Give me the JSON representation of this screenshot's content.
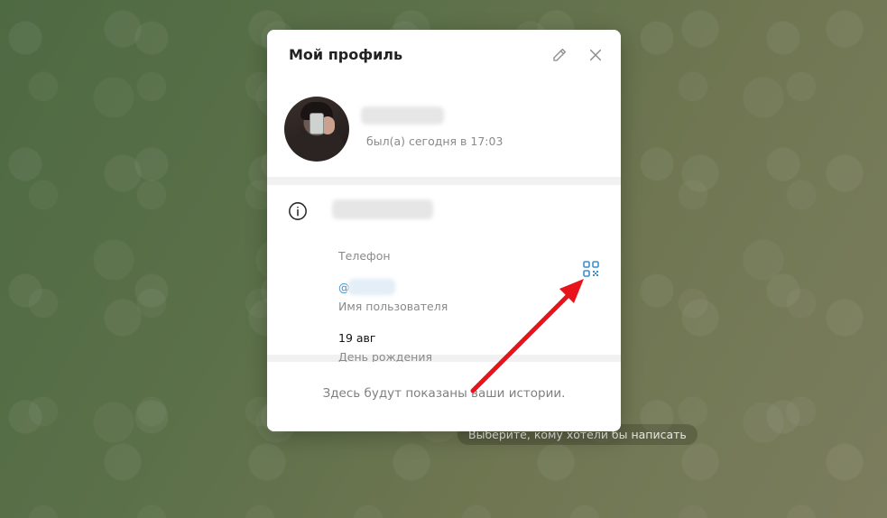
{
  "background": {
    "hint": "Выберите, кому хотели бы написать"
  },
  "modal": {
    "title": "Мой профиль",
    "edit_icon": "pencil-icon",
    "close_icon": "close-icon",
    "profile": {
      "last_seen": "был(а) сегодня в 17:03"
    },
    "info": {
      "info_icon": "info-icon",
      "phone_label": "Телефон",
      "username_prefix": "@",
      "username_label": "Имя пользователя",
      "qr_icon": "qr-code-icon",
      "birthday_value": "19 авг",
      "birthday_label": "День рождения"
    },
    "stories_text": "Здесь будут показаны ваши истории."
  },
  "colors": {
    "accent": "#3a8fd0",
    "annotation_arrow": "#e8141b",
    "secondary_text": "#8a8a8a"
  }
}
